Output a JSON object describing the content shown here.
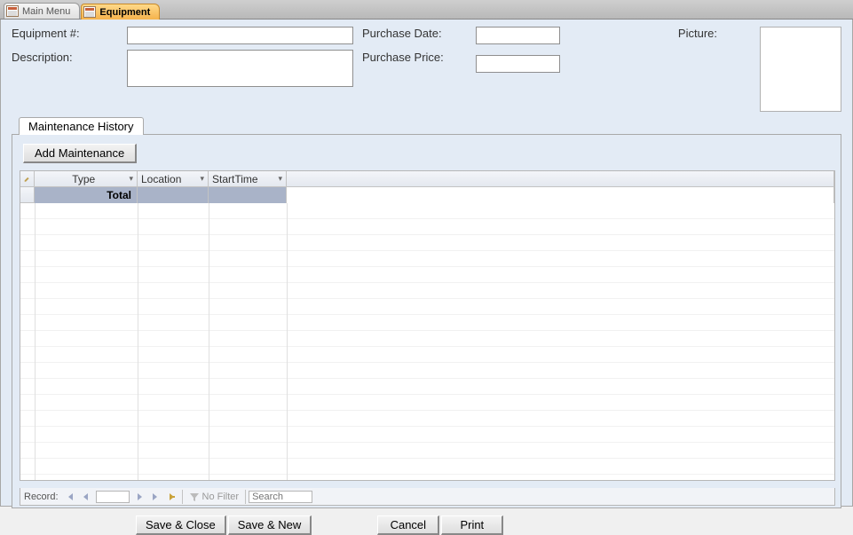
{
  "tabs": {
    "main_menu_label": "Main Menu",
    "equipment_label": "Equipment"
  },
  "fields": {
    "equipment_no_label": "Equipment #:",
    "description_label": "Description:",
    "purchase_date_label": "Purchase Date:",
    "purchase_price_label": "Purchase Price:",
    "picture_label": "Picture:",
    "equipment_no_value": "",
    "description_value": "",
    "purchase_date_value": "",
    "purchase_price_value": ""
  },
  "subform": {
    "tab_label": "Maintenance History",
    "add_button_label": "Add Maintenance",
    "columns": {
      "type": "Type",
      "location": "Location",
      "start_time": "StartTime"
    },
    "total_row_label": "Total"
  },
  "recnav": {
    "record_label": "Record:",
    "no_filter_label": "No Filter",
    "search_placeholder": "Search",
    "current_record": ""
  },
  "footer_buttons": {
    "save_close": "Save & Close",
    "save_new": "Save & New",
    "cancel": "Cancel",
    "print": "Print"
  }
}
